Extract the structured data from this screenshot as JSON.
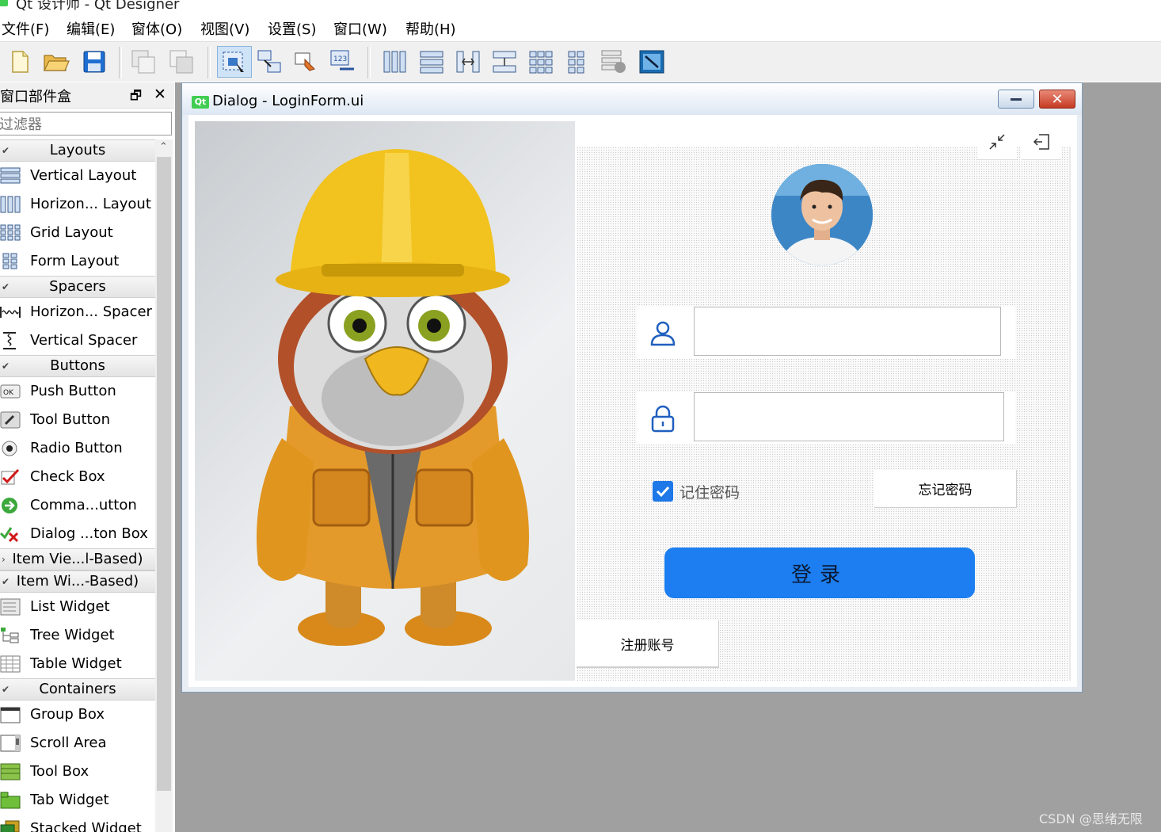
{
  "app": {
    "title": "Qt 设计师 - Qt Designer"
  },
  "menu": [
    {
      "label": "文件(F)"
    },
    {
      "label": "编辑(E)"
    },
    {
      "label": "窗体(O)"
    },
    {
      "label": "视图(V)"
    },
    {
      "label": "设置(S)"
    },
    {
      "label": "窗口(W)"
    },
    {
      "label": "帮助(H)"
    }
  ],
  "toolbar": {
    "buttons": [
      "new-file-icon",
      "open-folder-icon",
      "save-icon",
      "copy-icon",
      "paste-icon",
      "edit-widgets-icon",
      "edit-signals-slots-icon",
      "edit-buddies-icon",
      "edit-tab-order-icon",
      "layout-horizontal-icon",
      "layout-vertical-icon",
      "layout-h-splitter-icon",
      "layout-v-splitter-icon",
      "layout-grid-icon",
      "layout-form-icon",
      "break-layout-icon",
      "adjust-size-icon"
    ],
    "active_index": 5
  },
  "widgetbox": {
    "title": "窗口部件盒",
    "filter_placeholder": "过滤器",
    "categories": [
      {
        "name": "Layouts",
        "expanded": true,
        "items": [
          {
            "label": "Vertical Layout",
            "icon": "vertical-layout-icon"
          },
          {
            "label": "Horizon... Layout",
            "icon": "horizontal-layout-icon"
          },
          {
            "label": "Grid Layout",
            "icon": "grid-layout-icon"
          },
          {
            "label": "Form Layout",
            "icon": "form-layout-icon"
          }
        ]
      },
      {
        "name": "Spacers",
        "expanded": true,
        "items": [
          {
            "label": "Horizon... Spacer",
            "icon": "horizontal-spacer-icon"
          },
          {
            "label": "Vertical Spacer",
            "icon": "vertical-spacer-icon"
          }
        ]
      },
      {
        "name": "Buttons",
        "expanded": true,
        "items": [
          {
            "label": "Push Button",
            "icon": "push-button-icon"
          },
          {
            "label": "Tool Button",
            "icon": "tool-button-icon"
          },
          {
            "label": "Radio Button",
            "icon": "radio-button-icon"
          },
          {
            "label": "Check Box",
            "icon": "check-box-icon"
          },
          {
            "label": "Comma...utton",
            "icon": "command-link-button-icon"
          },
          {
            "label": "Dialog ...ton Box",
            "icon": "dialog-button-box-icon"
          }
        ]
      },
      {
        "name": "Item Vie...l-Based)",
        "expanded": false,
        "items": []
      },
      {
        "name": "Item Wi...-Based)",
        "expanded": true,
        "items": [
          {
            "label": "List Widget",
            "icon": "list-widget-icon"
          },
          {
            "label": "Tree Widget",
            "icon": "tree-widget-icon"
          },
          {
            "label": "Table Widget",
            "icon": "table-widget-icon"
          }
        ]
      },
      {
        "name": "Containers",
        "expanded": true,
        "items": [
          {
            "label": "Group Box",
            "icon": "group-box-icon"
          },
          {
            "label": "Scroll Area",
            "icon": "scroll-area-icon"
          },
          {
            "label": "Tool Box",
            "icon": "tool-box-icon"
          },
          {
            "label": "Tab Widget",
            "icon": "tab-widget-icon"
          },
          {
            "label": "Stacked Widget",
            "icon": "stacked-widget-icon"
          }
        ]
      }
    ]
  },
  "form_window": {
    "title": "Dialog - LoginForm.ui",
    "qt_badge": "Qt",
    "username": {
      "value": "",
      "icon": "user-icon"
    },
    "password": {
      "value": "",
      "icon": "lock-icon"
    },
    "remember": {
      "label": "记住密码",
      "checked": true
    },
    "forgot_label": "忘记密码",
    "login_label": "登录",
    "register_label": "注册账号",
    "accent_color": "#1c7ef0"
  },
  "watermark": "CSDN @思绪无限"
}
